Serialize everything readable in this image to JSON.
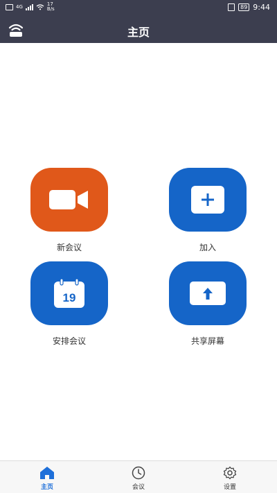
{
  "status_bar": {
    "network": "4G",
    "speed_value": "17",
    "speed_unit": "B/s",
    "battery": "89",
    "time": "9:44"
  },
  "header": {
    "title": "主页",
    "left_icon": "wifi-icon"
  },
  "actions": [
    {
      "label": "新会议",
      "icon": "video-camera-icon",
      "color": "#e0581a"
    },
    {
      "label": "加入",
      "icon": "plus-icon",
      "color": "#1565c8"
    },
    {
      "label": "安排会议",
      "icon": "calendar-icon",
      "icon_text": "19",
      "color": "#1565c8"
    },
    {
      "label": "共享屏幕",
      "icon": "upload-icon",
      "color": "#1565c8"
    }
  ],
  "tabbar": {
    "items": [
      {
        "label": "主页",
        "icon": "home-icon",
        "active": true
      },
      {
        "label": "会议",
        "icon": "clock-icon",
        "active": false
      },
      {
        "label": "设置",
        "icon": "gear-icon",
        "active": false
      }
    ],
    "active_color": "#1e6fd9"
  }
}
